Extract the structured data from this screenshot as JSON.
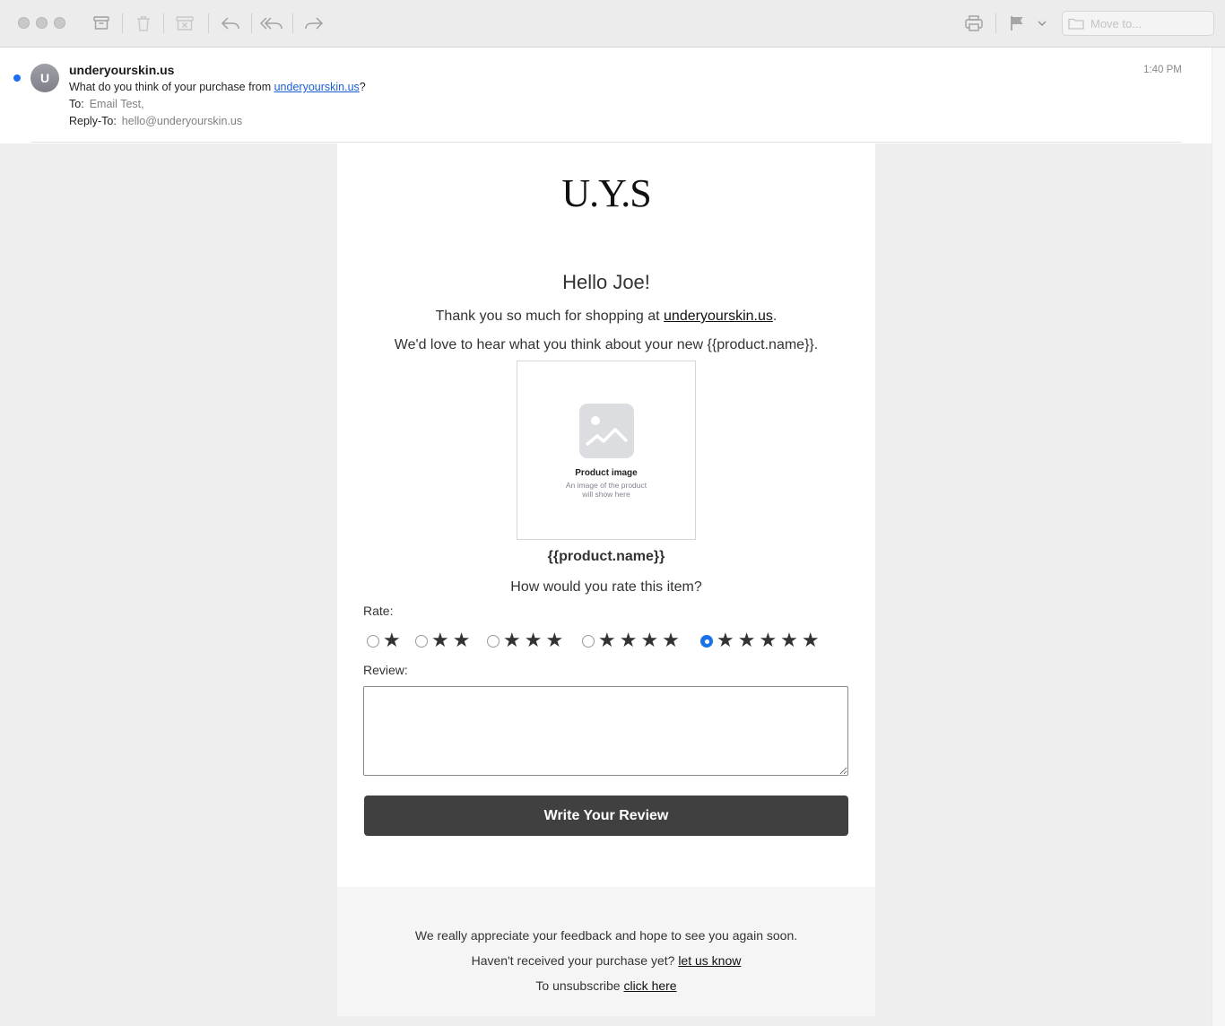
{
  "toolbar": {
    "move_to_placeholder": "Move to..."
  },
  "message": {
    "avatar_initial": "U",
    "from": "underyourskin.us",
    "subject_prefix": "What do you think of your purchase from ",
    "subject_link": "underyourskin.us",
    "subject_suffix": "?",
    "to_label": "To:",
    "to_value": "Email Test,",
    "reply_to_label": "Reply-To:",
    "reply_to_value": "hello@underyourskin.us",
    "time": "1:40 PM"
  },
  "email": {
    "logo": "U.Y.S",
    "greeting": "Hello Joe!",
    "thanks_prefix": "Thank you so much for shopping at ",
    "thanks_link": "underyourskin.us",
    "thanks_suffix": ".",
    "love_to_hear": "We'd love to hear what you think about your new {{product.name}}.",
    "placeholder_title": "Product image",
    "placeholder_sub_1": "An image of the product",
    "placeholder_sub_2": "will show here",
    "product_name": "{{product.name}}",
    "question": "How would you rate this item?",
    "rate_label": "Rate:",
    "rating_options": [
      {
        "stars": "★",
        "checked": false
      },
      {
        "stars": "★★",
        "checked": false
      },
      {
        "stars": "★★★",
        "checked": false
      },
      {
        "stars": "★★★★",
        "checked": false
      },
      {
        "stars": "★★★★★",
        "checked": true
      }
    ],
    "selected_rating": 5,
    "review_label": "Review:",
    "review_value": "",
    "cta_label": "Write Your Review"
  },
  "footer": {
    "line1": "We really appreciate your feedback and hope to see you again soon.",
    "line2_prefix": "Haven't received your purchase yet? ",
    "line2_link": "let us know",
    "line3_prefix": "To unsubscribe ",
    "line3_link": "click here"
  },
  "colors": {
    "accent_blue": "#1a73e8",
    "unread_dot": "#1d6ff2",
    "cta_bg": "#404040"
  }
}
